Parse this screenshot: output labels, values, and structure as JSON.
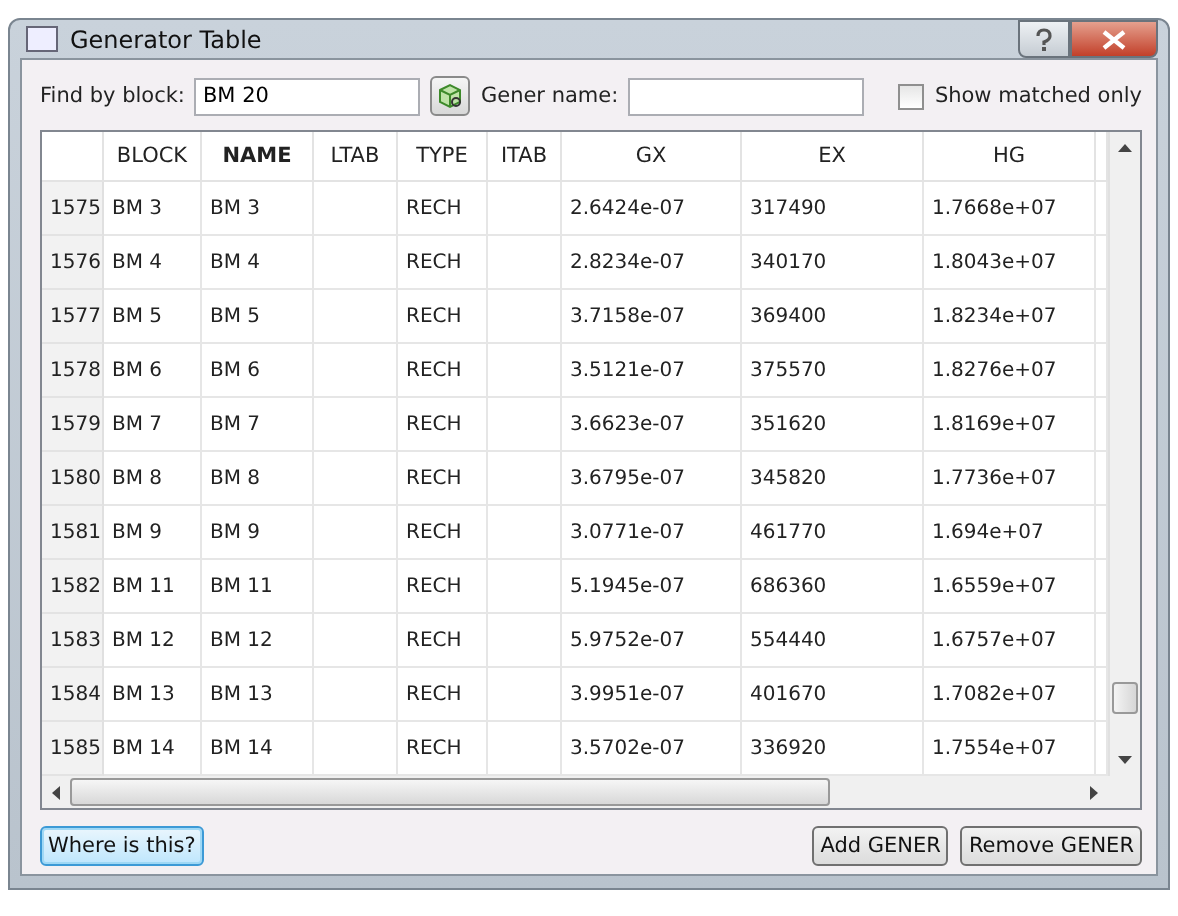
{
  "window": {
    "title": "Generator Table"
  },
  "toolbar": {
    "block_label": "Find by block:",
    "block_value": "BM 20",
    "name_label": "Gener name:",
    "show_matched": {
      "label": "Show matched only",
      "checked": false
    }
  },
  "table": {
    "columns": [
      {
        "label": "BLOCK",
        "bold": false
      },
      {
        "label": "NAME",
        "bold": true
      },
      {
        "label": "LTAB",
        "bold": false
      },
      {
        "label": "TYPE",
        "bold": false
      },
      {
        "label": "ITAB",
        "bold": false
      },
      {
        "label": "GX",
        "bold": false
      },
      {
        "label": "EX",
        "bold": false
      },
      {
        "label": "HG",
        "bold": false
      }
    ],
    "rows": [
      {
        "number": "1575",
        "cells": [
          "BM 3",
          "BM 3",
          "",
          "RECH",
          "",
          "2.6424e-07",
          "317490",
          "1.7668e+07"
        ]
      },
      {
        "number": "1576",
        "cells": [
          "BM 4",
          "BM 4",
          "",
          "RECH",
          "",
          "2.8234e-07",
          "340170",
          "1.8043e+07"
        ]
      },
      {
        "number": "1577",
        "cells": [
          "BM 5",
          "BM 5",
          "",
          "RECH",
          "",
          "3.7158e-07",
          "369400",
          "1.8234e+07"
        ]
      },
      {
        "number": "1578",
        "cells": [
          "BM 6",
          "BM 6",
          "",
          "RECH",
          "",
          "3.5121e-07",
          "375570",
          "1.8276e+07"
        ]
      },
      {
        "number": "1579",
        "cells": [
          "BM 7",
          "BM 7",
          "",
          "RECH",
          "",
          "3.6623e-07",
          "351620",
          "1.8169e+07"
        ]
      },
      {
        "number": "1580",
        "cells": [
          "BM 8",
          "BM 8",
          "",
          "RECH",
          "",
          "3.6795e-07",
          "345820",
          "1.7736e+07"
        ]
      },
      {
        "number": "1581",
        "cells": [
          "BM 9",
          "BM 9",
          "",
          "RECH",
          "",
          "3.0771e-07",
          "461770",
          "1.694e+07"
        ]
      },
      {
        "number": "1582",
        "cells": [
          "BM 11",
          "BM 11",
          "",
          "RECH",
          "",
          "5.1945e-07",
          "686360",
          "1.6559e+07"
        ]
      },
      {
        "number": "1583",
        "cells": [
          "BM 12",
          "BM 12",
          "",
          "RECH",
          "",
          "5.9752e-07",
          "554440",
          "1.6757e+07"
        ]
      },
      {
        "number": "1584",
        "cells": [
          "BM 13",
          "BM 13",
          "",
          "RECH",
          "",
          "3.9951e-07",
          "401670",
          "1.7082e+07"
        ]
      },
      {
        "number": "1585",
        "cells": [
          "BM 14",
          "BM 14",
          "",
          "RECH",
          "",
          "3.5702e-07",
          "336920",
          "1.7554e+07"
        ]
      }
    ]
  },
  "buttons": {
    "left": [
      "Where is this?"
    ],
    "right": [
      "Add GENER",
      "Remove GENER"
    ]
  }
}
